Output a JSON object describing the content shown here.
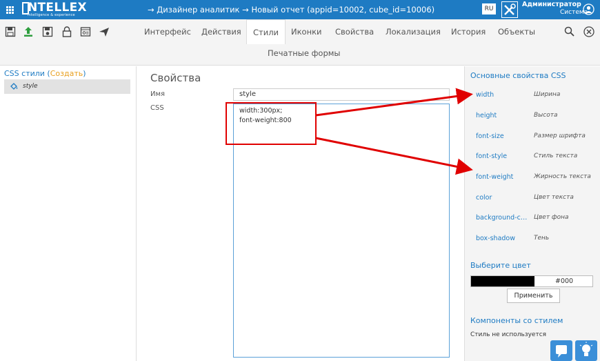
{
  "header": {
    "logo_text": "NTELLEX",
    "logo_sub": "intelligence & experience",
    "breadcrumb": "→ Дизайнер аналитик → Новый отчет (appid=10002, cube_id=10006)",
    "lang": "RU",
    "user_name": "Администратор",
    "user_role": "Система"
  },
  "toolbar": {
    "tabs": [
      "Интерфейс",
      "Действия",
      "Стили",
      "Иконки",
      "Свойства",
      "Локализация",
      "История",
      "Объекты"
    ],
    "active_tab": "Стили",
    "second_row_tab": "Печатные формы"
  },
  "left": {
    "title_prefix": "CSS стили (",
    "create_label": "Создать",
    "title_suffix": ")",
    "items": [
      {
        "label": "style"
      }
    ]
  },
  "main": {
    "title": "Свойства",
    "name_label": "Имя",
    "name_value": "style",
    "css_label": "CSS",
    "css_lines": [
      "width:300px;",
      "font-weight:800"
    ]
  },
  "right": {
    "props_title": "Основные свойства CSS",
    "props": [
      {
        "name": "width",
        "desc": "Ширина"
      },
      {
        "name": "height",
        "desc": "Высота"
      },
      {
        "name": "font-size",
        "desc": "Размер шрифта"
      },
      {
        "name": "font-style",
        "desc": "Стиль текста"
      },
      {
        "name": "font-weight",
        "desc": "Жирность текста"
      },
      {
        "name": "color",
        "desc": "Цвет текста"
      },
      {
        "name": "background-color",
        "desc": "Цвет фона"
      },
      {
        "name": "box-shadow",
        "desc": "Тень"
      }
    ],
    "color_title": "Выберите цвет",
    "color_value": "#000",
    "apply_label": "Применить",
    "components_title": "Компоненты со стилем",
    "components_empty": "Стиль не используется"
  },
  "colors": {
    "accent": "#1e7bc3",
    "annotation": "#e00000"
  }
}
